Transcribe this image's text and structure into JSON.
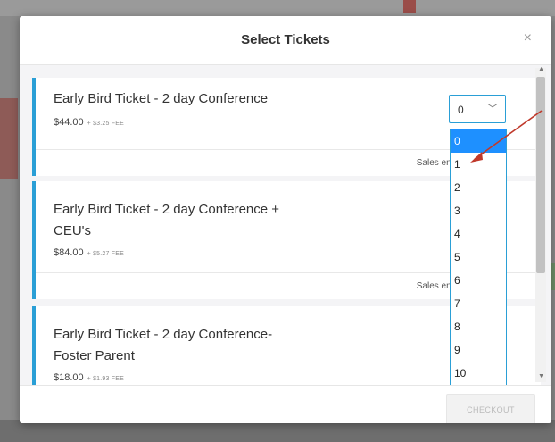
{
  "modal": {
    "title": "Select Tickets",
    "close_glyph": "×"
  },
  "tickets": [
    {
      "name_lines": [
        "Early Bird Ticket - 2 day Conference"
      ],
      "price": "$44.00",
      "fee": "+ $3.25 FEE",
      "sales_end": "Sales end on F"
    },
    {
      "name_lines": [
        "Early Bird Ticket - 2 day Conference +",
        "CEU's"
      ],
      "price": "$84.00",
      "fee": "+ $5.27 FEE",
      "sales_end": "Sales end on F"
    },
    {
      "name_lines": [
        "Early Bird Ticket - 2 day Conference-",
        "Foster Parent"
      ],
      "price": "$18.00",
      "fee": "+ $1.93 FEE"
    }
  ],
  "quantity_select": {
    "value": "0",
    "options": [
      "0",
      "1",
      "2",
      "3",
      "4",
      "5",
      "6",
      "7",
      "8",
      "9",
      "10"
    ],
    "selected_index": 0
  },
  "footer": {
    "checkout_label": "CHECKOUT"
  },
  "colors": {
    "accent": "#2a9fd6",
    "selected_option": "#1e90ff",
    "annotation_arrow": "#c0392b"
  }
}
